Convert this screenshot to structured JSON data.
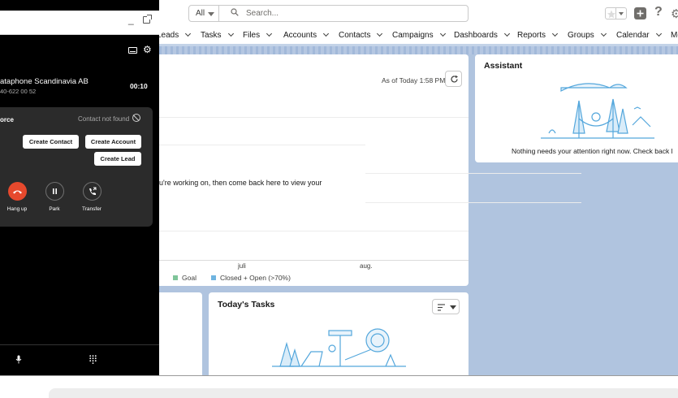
{
  "header": {
    "search_scope": "All",
    "search_placeholder": "Search...",
    "help_glyph": "?",
    "icons": [
      "search-icon",
      "star-icon",
      "chevron-down-icon",
      "plus-icon",
      "help-icon",
      "gear-icon"
    ]
  },
  "nav": {
    "items": [
      "Leads",
      "Tasks",
      "Files",
      "Accounts",
      "Contacts",
      "Campaigns",
      "Dashboards",
      "Reports",
      "Groups",
      "Calendar",
      "Mo"
    ]
  },
  "phone": {
    "caller_name": "ataphone Scandinavia AB",
    "caller_number": "40-622 00 52",
    "timer": "00:10",
    "crm_label": "orce",
    "crm_status": "Contact not found",
    "create_contact": "Create Contact",
    "create_account": "Create Account",
    "create_lead": "Create Lead",
    "hangup": "Hang up",
    "park": "Park",
    "transfer": "Transfer",
    "hangup_color": "#e6492d",
    "icons": [
      "screen-icon",
      "gear-icon",
      "block-icon",
      "phone-hangup-icon",
      "pause-icon",
      "transfer-icon",
      "microphone-icon",
      "keypad-icon"
    ]
  },
  "performance": {
    "as_of": "As of Today 1:58 PM",
    "message": "u're working on, then come back here to view your",
    "x_ticks": [
      "juli",
      "aug."
    ],
    "legend": [
      {
        "label": "Goal",
        "color": "#7fc59a"
      },
      {
        "label": "Closed + Open (>70%)",
        "color": "#6fb4e0"
      }
    ]
  },
  "assistant": {
    "title": "Assistant",
    "message": "Nothing needs your attention right now. Check back l"
  },
  "tasks": {
    "title": "Today's Tasks"
  },
  "colors": {
    "background": "#b0c4df",
    "illustration": "#54a7dc"
  }
}
